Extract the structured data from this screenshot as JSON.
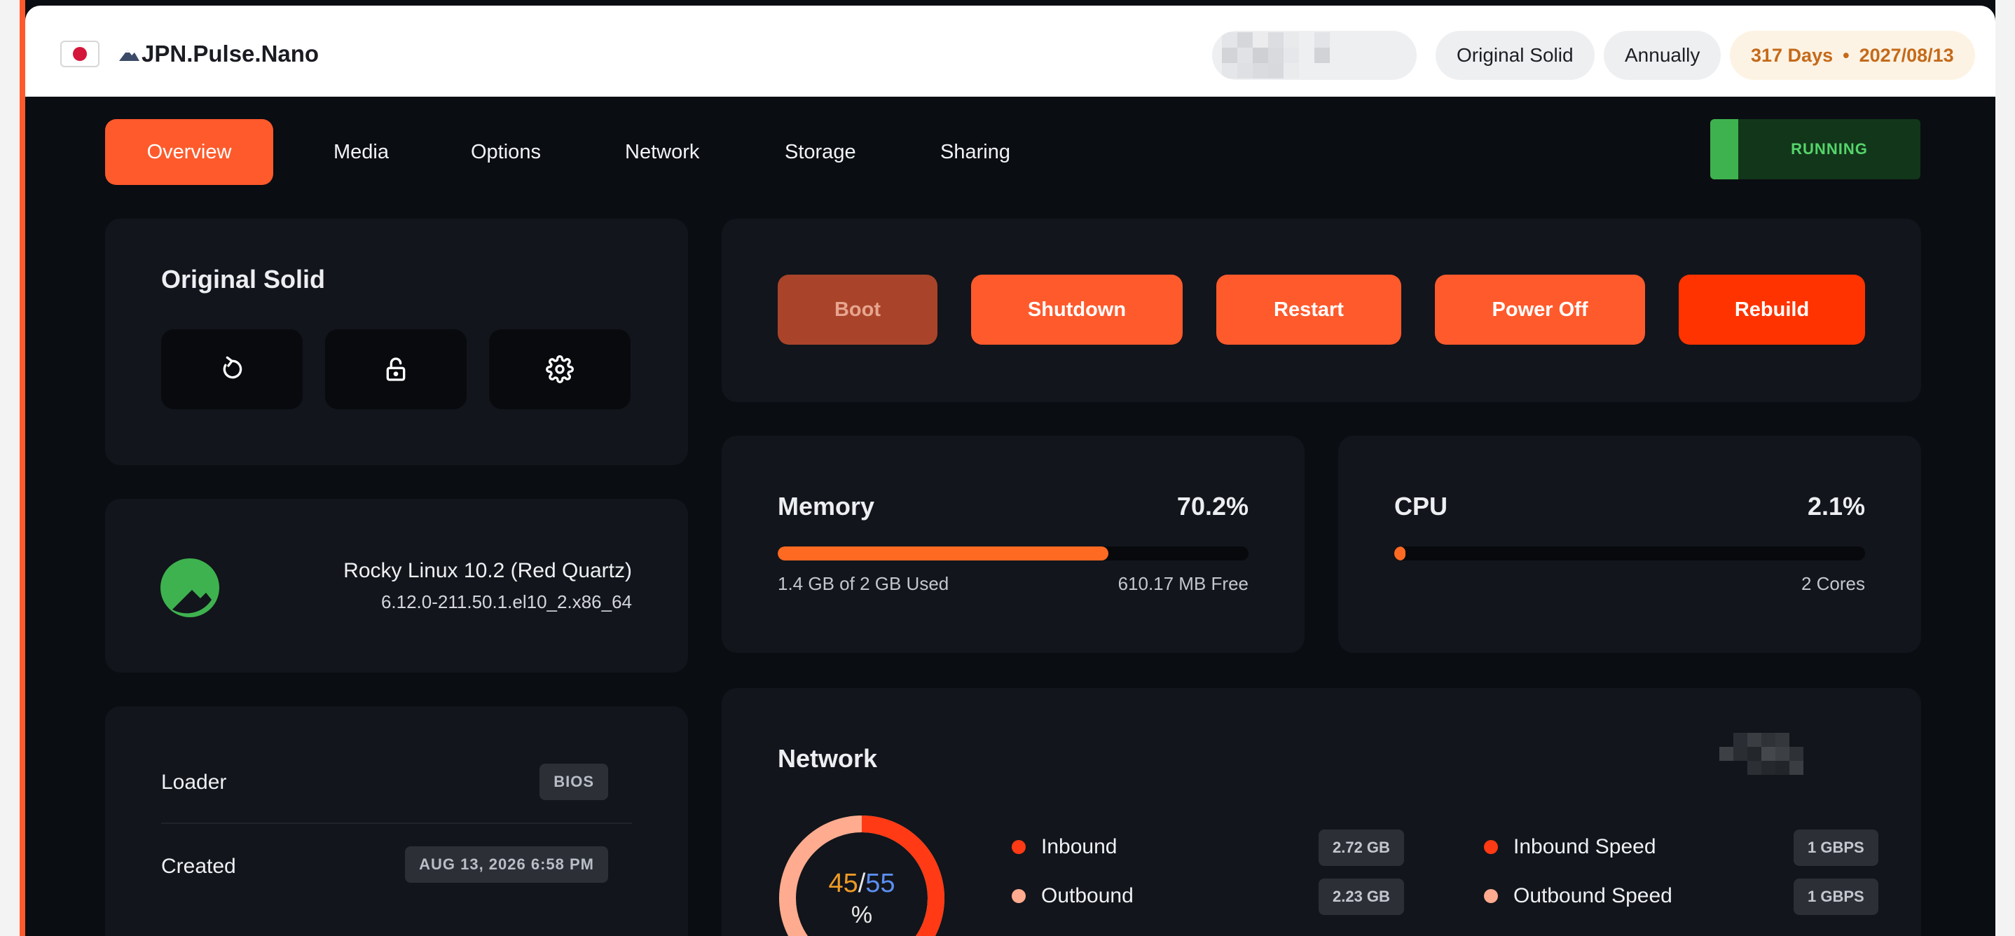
{
  "header": {
    "server_name": "JPN.Pulse.Nano",
    "plan": "Original Solid",
    "billing_cycle": "Annually",
    "expiry_days": "317 Days",
    "expiry_separator": "•",
    "expiry_date": "2027/08/13"
  },
  "tabs": [
    {
      "label": "Overview",
      "active": true
    },
    {
      "label": "Media"
    },
    {
      "label": "Options"
    },
    {
      "label": "Network"
    },
    {
      "label": "Storage"
    },
    {
      "label": "Sharing"
    }
  ],
  "status": {
    "label": "RUNNING"
  },
  "plan_card": {
    "title": "Original Solid",
    "actions": [
      "refresh-icon",
      "unlock-icon",
      "gear-icon"
    ]
  },
  "power": {
    "boot": "Boot",
    "shutdown": "Shutdown",
    "restart": "Restart",
    "power_off": "Power Off",
    "rebuild": "Rebuild"
  },
  "os": {
    "name": "Rocky Linux 10.2 (Red Quartz)",
    "kernel": "6.12.0-211.50.1.el10_2.x86_64"
  },
  "memory": {
    "title": "Memory",
    "percent": "70.2%",
    "fraction": 0.702,
    "used_text": "1.4 GB of 2 GB Used",
    "free_text": "610.17 MB Free"
  },
  "cpu": {
    "title": "CPU",
    "percent": "2.1%",
    "fraction": 0.021,
    "cores_text": "2 Cores"
  },
  "info": {
    "loader_label": "Loader",
    "loader_value": "BIOS",
    "created_label": "Created",
    "created_value": "AUG 13, 2026 6:58 PM"
  },
  "network": {
    "title": "Network",
    "donut_left": "45",
    "donut_sep": "/",
    "donut_right": "55",
    "donut_unit": "%",
    "inbound_label": "Inbound",
    "inbound_value": "2.72 GB",
    "outbound_label": "Outbound",
    "outbound_value": "2.23 GB",
    "inbound_speed_label": "Inbound Speed",
    "inbound_speed_value": "1 GBPS",
    "outbound_speed_label": "Outbound Speed",
    "outbound_speed_value": "1 GBPS"
  },
  "colors": {
    "accent": "#ff5a2c",
    "danger": "#ff3300",
    "running": "#3eb24f",
    "inbound_dot": "#ff3a14",
    "outbound_dot": "#ffab8f"
  }
}
